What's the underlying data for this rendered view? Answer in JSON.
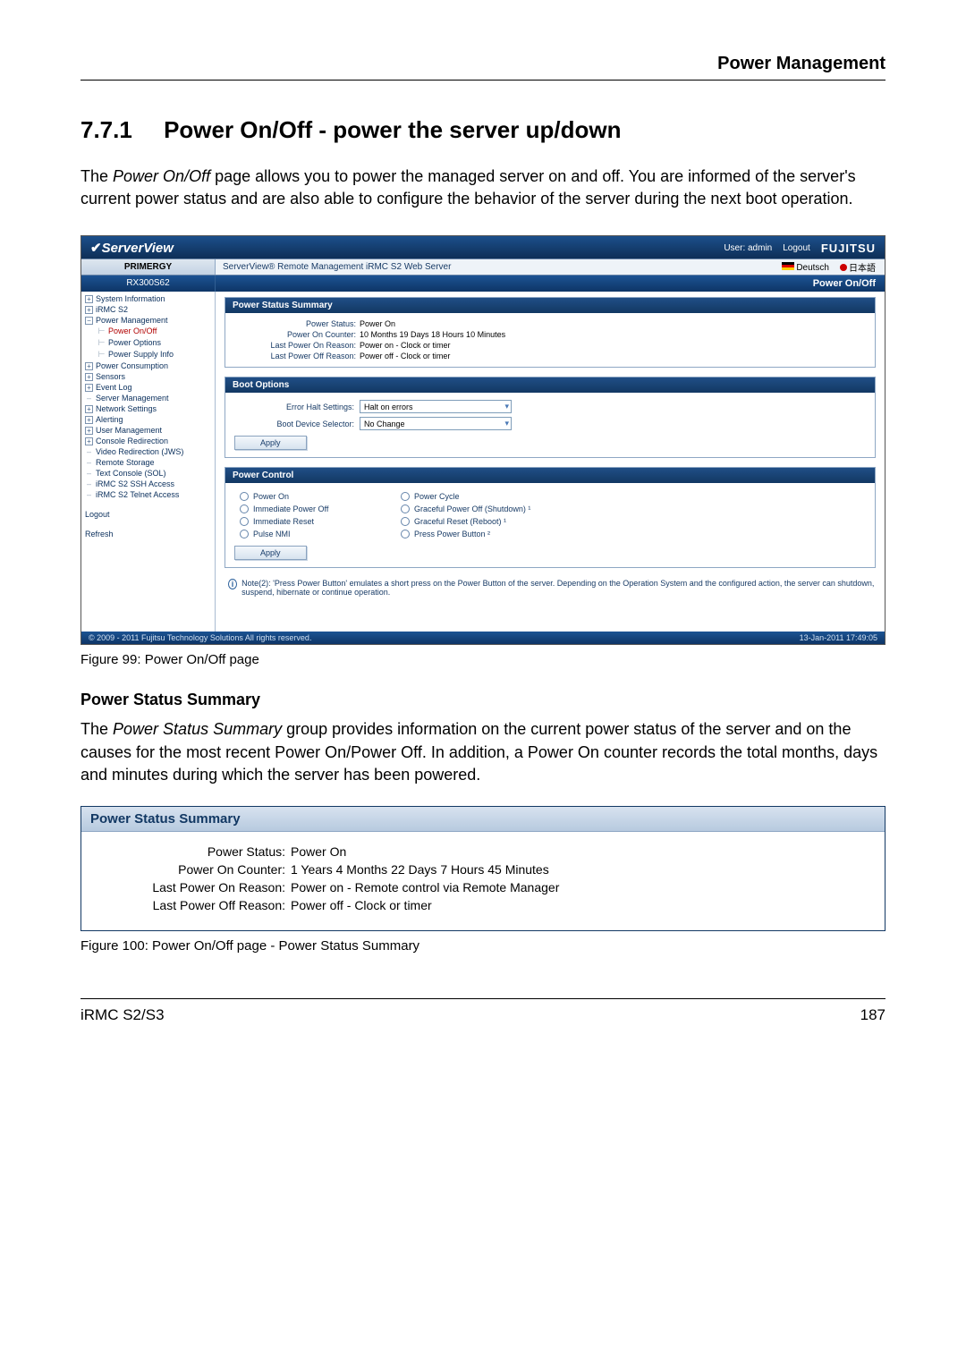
{
  "page": {
    "header_right": "Power Management",
    "section_number": "7.7.1",
    "section_title": "Power On/Off - power the server up/down",
    "intro_pre": "The ",
    "intro_ital": "Power On/Off",
    "intro_post": " page allows you to power the managed server on and off. You are informed of the server's current power status and are also able to configure the behavior of the server during the next boot operation.",
    "footer_left": "iRMC S2/S3",
    "footer_right": "187"
  },
  "shot": {
    "brand": "ServerView",
    "user_label": "User: admin",
    "logout": "Logout",
    "vendor": "FUJITSU",
    "primergy": "PRIMERGY",
    "subtitle": "ServerView® Remote Management iRMC S2 Web Server",
    "lang_de": "Deutsch",
    "lang_jp": "日本語",
    "model": "RX300S62",
    "right_title": "Power On/Off",
    "sidebar": [
      {
        "exp": "+",
        "label": "System Information"
      },
      {
        "exp": "+",
        "label": "iRMC S2"
      },
      {
        "exp": "−",
        "label": "Power Management"
      },
      {
        "indent": true,
        "bar": true,
        "label": "Power On/Off",
        "red": true
      },
      {
        "indent": true,
        "bar": true,
        "label": "Power Options"
      },
      {
        "indent": true,
        "bar": true,
        "label": "Power Supply Info"
      },
      {
        "exp": "+",
        "label": "Power Consumption"
      },
      {
        "exp": "+",
        "label": "Sensors"
      },
      {
        "exp": "+",
        "label": "Event Log"
      },
      {
        "indent": false,
        "dash": true,
        "label": "Server Management"
      },
      {
        "exp": "+",
        "label": "Network Settings"
      },
      {
        "exp": "+",
        "label": "Alerting"
      },
      {
        "exp": "+",
        "label": "User Management"
      },
      {
        "exp": "+",
        "label": "Console Redirection"
      },
      {
        "indent": false,
        "dash": true,
        "label": "Video Redirection (JWS)"
      },
      {
        "indent": false,
        "dash": true,
        "label": "Remote Storage"
      },
      {
        "indent": false,
        "dash": true,
        "label": "Text Console (SOL)"
      },
      {
        "indent": false,
        "dash": true,
        "label": "iRMC S2 SSH Access"
      },
      {
        "indent": false,
        "dash": true,
        "label": "iRMC S2 Telnet Access"
      },
      {
        "blank": true
      },
      {
        "indent": false,
        "label": "Logout"
      },
      {
        "blank": true
      },
      {
        "indent": false,
        "label": "Refresh"
      }
    ],
    "pss_title": "Power Status Summary",
    "pss_rows": [
      {
        "l": "Power Status:",
        "v": "Power On"
      },
      {
        "l": "Power On Counter:",
        "v": "10 Months 19 Days 18 Hours 10 Minutes"
      },
      {
        "l": "Last Power On Reason:",
        "v": "Power on - Clock or timer"
      },
      {
        "l": "Last Power Off Reason:",
        "v": "Power off - Clock or timer"
      }
    ],
    "boot_title": "Boot Options",
    "boot_rows": [
      {
        "l": "Error Halt Settings:",
        "v": "Halt on errors"
      },
      {
        "l": "Boot Device Selector:",
        "v": "No Change"
      }
    ],
    "apply": "Apply",
    "pc_title": "Power Control",
    "pc_opts": [
      [
        "Power On",
        "Power Cycle"
      ],
      [
        "Immediate Power Off",
        "Graceful Power Off (Shutdown) ¹"
      ],
      [
        "Immediate Reset",
        "Graceful Reset (Reboot) ¹"
      ],
      [
        "Pulse NMI",
        "Press Power Button ²"
      ]
    ],
    "note": "Note(2): 'Press Power Button' emulates a short press on the Power Button of the server. Depending on the Operation System and the configured action, the server can shutdown, suspend, hibernate or continue operation.",
    "copyright": "© 2009 - 2011 Fujitsu Technology Solutions All rights reserved.",
    "timestamp": "13-Jan-2011 17:49:05",
    "caption": "Figure 99: Power On/Off page"
  },
  "sub": {
    "heading": "Power Status Summary",
    "para_pre": "The ",
    "para_ital": "Power Status Summary",
    "para_post": " group provides information on the current power status of the server and on the causes for the most recent Power On/Power Off. In addition, a Power On counter records the total months, days and minutes during which the server has been powered."
  },
  "shot2": {
    "title": "Power Status Summary",
    "rows": [
      {
        "l": "Power Status:",
        "v": "Power On"
      },
      {
        "l": "Power On Counter:",
        "v": "1 Years 4 Months 22 Days 7 Hours 45 Minutes"
      },
      {
        "l": "Last Power On Reason:",
        "v": "Power on - Remote control via Remote Manager"
      },
      {
        "l": "Last Power Off Reason:",
        "v": "Power off - Clock or timer"
      }
    ],
    "caption": "Figure 100: Power On/Off page - Power Status Summary"
  }
}
